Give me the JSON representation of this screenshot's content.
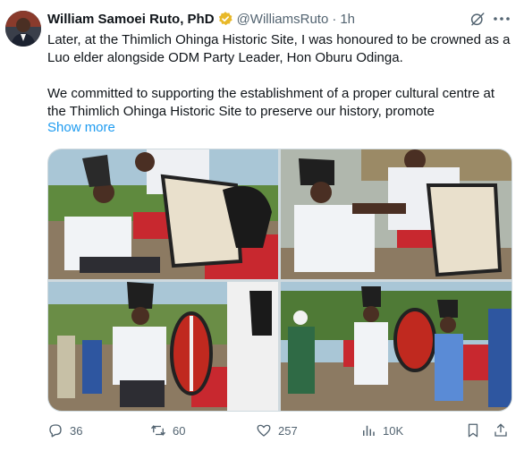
{
  "post": {
    "author_name": "William Samoei Ruto, PhD",
    "handle": "@WilliamsRuto",
    "separator": "·",
    "time": "1h",
    "paragraph_1": "Later, at the Thimlich Ohinga Historic Site, I was honoured to be crowned as a Luo elder alongside ODM Party Leader, Hon Oburu Odinga.",
    "paragraph_2": "We committed to supporting the establishment of a proper cultural centre at the Thimlich Ohinga Historic Site to preserve our history, promote",
    "show_more": "Show more"
  },
  "media": {
    "photos": [
      {
        "name": "photo-crowning-seated"
      },
      {
        "name": "photo-headdress-placed"
      },
      {
        "name": "photo-elder-with-shield"
      },
      {
        "name": "photo-elders-standing"
      }
    ]
  },
  "actions": {
    "replies": "36",
    "reposts": "60",
    "likes": "257",
    "views": "10K"
  },
  "colors": {
    "accent": "#1d9bf0",
    "secondary_text": "#536471",
    "verified_badge": "#e8b828"
  },
  "icons": [
    "verified-badge-icon",
    "grok-icon",
    "more-icon",
    "reply-icon",
    "repost-icon",
    "like-icon",
    "views-icon",
    "bookmark-icon",
    "share-icon"
  ]
}
